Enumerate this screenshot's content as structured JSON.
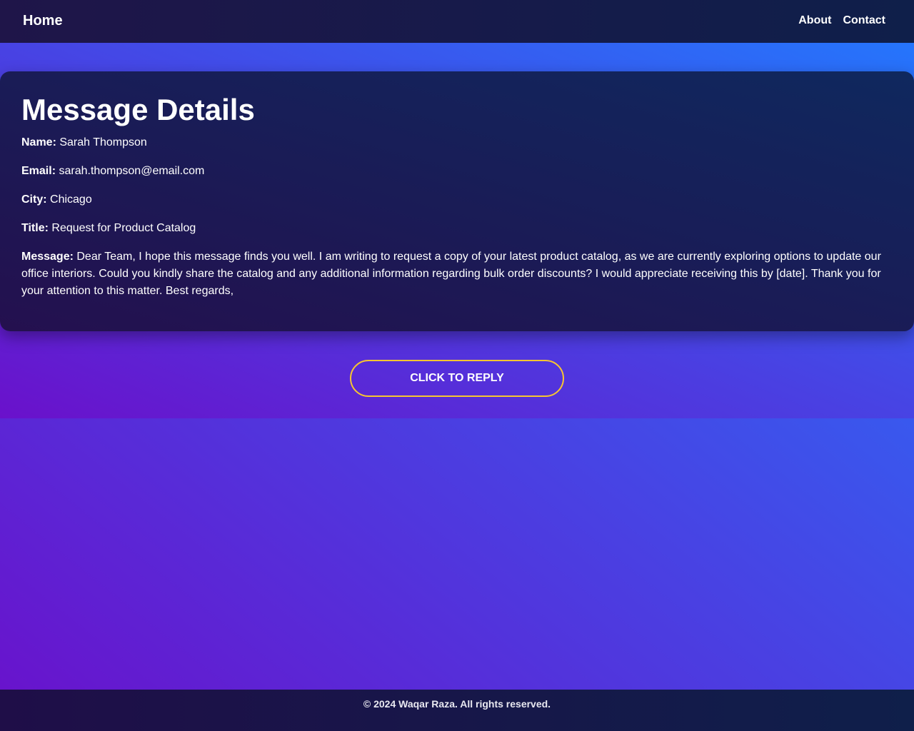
{
  "header": {
    "brand": "Home",
    "nav": [
      "About",
      "Contact"
    ]
  },
  "message": {
    "heading": "Message Details",
    "name_label": "Name:",
    "name": "Sarah Thompson",
    "email_label": "Email:",
    "email": "sarah.thompson@email.com",
    "city_label": "City:",
    "city": "Chicago",
    "title_label": "Title:",
    "title": "Request for Product Catalog",
    "message_label": "Message:",
    "body": "Dear Team, I hope this message finds you well. I am writing to request a copy of your latest product catalog, as we are currently exploring options to update our office interiors. Could you kindly share the catalog and any additional information regarding bulk order discounts? I would appreciate receiving this by [date]. Thank you for your attention to this matter. Best regards,"
  },
  "actions": {
    "reply_label": "Click to Reply"
  },
  "footer": {
    "text": "© 2024 Waqar Raza. All rights reserved."
  },
  "colors": {
    "gradient_start": "#6a11cb",
    "gradient_end": "#2575fc",
    "button_border": "#f7c531"
  }
}
